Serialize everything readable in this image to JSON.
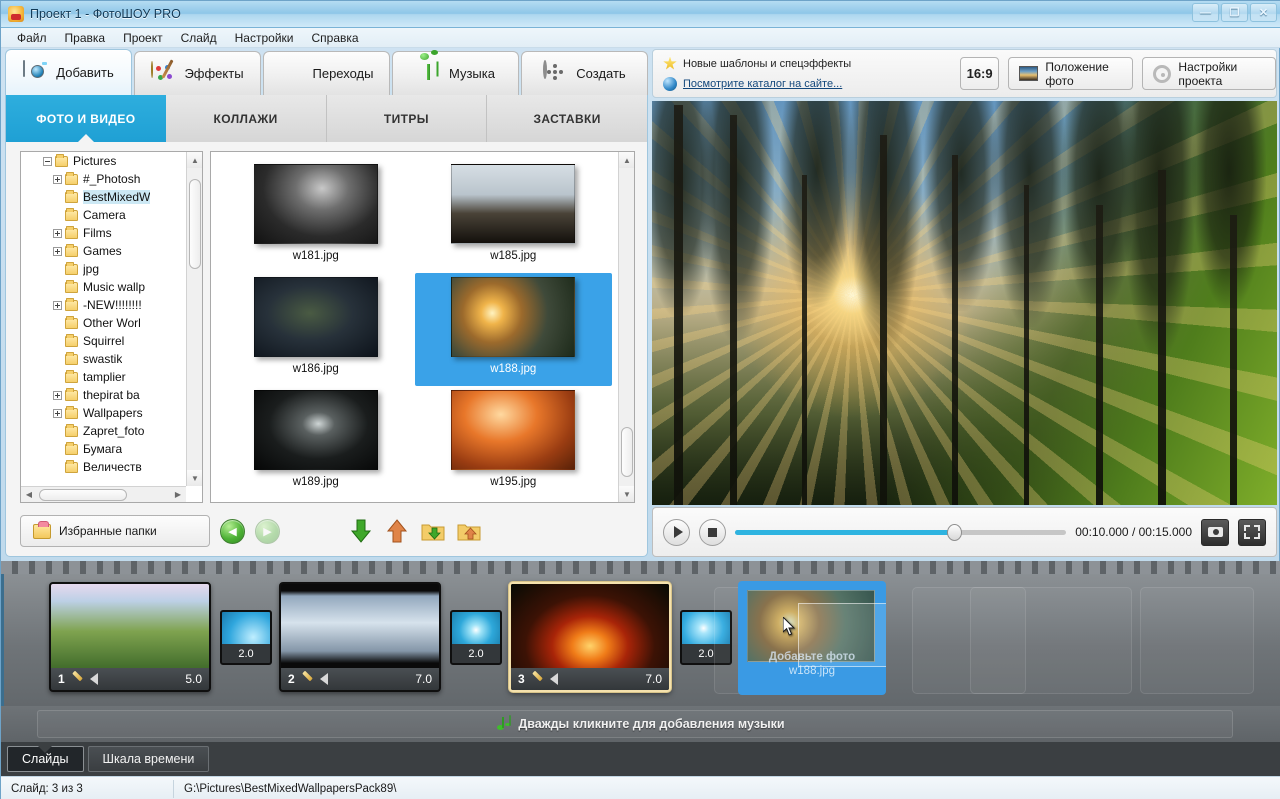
{
  "window": {
    "title": "Проект 1 - ФотоШОУ PRO",
    "app_icon": "crown-pro-icon",
    "minimize_label": "—",
    "maximize_label": "❐",
    "close_label": "✕"
  },
  "menu": {
    "items": [
      {
        "label": "Файл"
      },
      {
        "label": "Правка"
      },
      {
        "label": "Проект"
      },
      {
        "label": "Слайд"
      },
      {
        "label": "Настройки"
      },
      {
        "label": "Справка"
      }
    ]
  },
  "main_tabs": [
    {
      "label": "Добавить",
      "icon": "camera-icon",
      "active": true
    },
    {
      "label": "Эффекты",
      "icon": "palette-icon",
      "active": false
    },
    {
      "label": "Переходы",
      "icon": "star-icon",
      "active": false
    },
    {
      "label": "Музыка",
      "icon": "music-note-icon",
      "active": false
    },
    {
      "label": "Создать",
      "icon": "film-reel-icon",
      "active": false
    }
  ],
  "sub_tabs": [
    {
      "label": "ФОТО И ВИДЕО",
      "active": true
    },
    {
      "label": "КОЛЛАЖИ",
      "active": false
    },
    {
      "label": "ТИТРЫ",
      "active": false
    },
    {
      "label": "ЗАСТАВКИ",
      "active": false
    }
  ],
  "folder_tree": {
    "nodes": [
      {
        "label": "Pictures",
        "level": 0,
        "expander": "minus",
        "selected": false
      },
      {
        "label": "#_Photosh",
        "level": 1,
        "expander": "plus",
        "selected": false
      },
      {
        "label": "BestMixedW",
        "level": 1,
        "expander": "none",
        "selected": true
      },
      {
        "label": "Camera",
        "level": 1,
        "expander": "none",
        "selected": false
      },
      {
        "label": "Films",
        "level": 1,
        "expander": "plus",
        "selected": false
      },
      {
        "label": "Games",
        "level": 1,
        "expander": "plus",
        "selected": false
      },
      {
        "label": "jpg",
        "level": 1,
        "expander": "none",
        "selected": false
      },
      {
        "label": "Music wallp",
        "level": 1,
        "expander": "none",
        "selected": false
      },
      {
        "label": "-NEW!!!!!!!!",
        "level": 1,
        "expander": "plus",
        "selected": false
      },
      {
        "label": "Other Worl",
        "level": 1,
        "expander": "none",
        "selected": false
      },
      {
        "label": "Squirrel",
        "level": 1,
        "expander": "none",
        "selected": false
      },
      {
        "label": "swastik",
        "level": 1,
        "expander": "none",
        "selected": false
      },
      {
        "label": "tamplier",
        "level": 1,
        "expander": "none",
        "selected": false
      },
      {
        "label": "thepirat ba",
        "level": 1,
        "expander": "plus",
        "selected": false
      },
      {
        "label": "Wallpapers",
        "level": 1,
        "expander": "plus",
        "selected": false
      },
      {
        "label": "Zapret_foto",
        "level": 1,
        "expander": "none",
        "selected": false
      },
      {
        "label": "Бумага",
        "level": 1,
        "expander": "none",
        "selected": false
      },
      {
        "label": "Величеств",
        "level": 1,
        "expander": "none",
        "selected": false
      }
    ]
  },
  "file_grid": {
    "items": [
      {
        "name": "w181.jpg",
        "art": "img-w181",
        "selected": false
      },
      {
        "name": "w185.jpg",
        "art": "img-w185",
        "selected": false
      },
      {
        "name": "w186.jpg",
        "art": "img-w186",
        "selected": false
      },
      {
        "name": "w188.jpg",
        "art": "img-w188",
        "selected": true
      },
      {
        "name": "w189.jpg",
        "art": "img-w189",
        "selected": false
      },
      {
        "name": "w195.jpg",
        "art": "img-w195",
        "selected": false
      }
    ]
  },
  "left_toolbar": {
    "favorites_label": "Избранные папки",
    "back_icon": "back-arrow-icon",
    "forward_icon": "forward-arrow-icon",
    "add_down_icon": "green-down-arrow-icon",
    "remove_up_icon": "orange-up-arrow-icon",
    "add_folder_icon": "folder-down-icon",
    "remove_folder_icon": "folder-up-icon"
  },
  "preview_header": {
    "promo_title": "Новые шаблоны и спецэффекты",
    "promo_link": "Посмотрите каталог на сайте...",
    "aspect_ratio": "16:9",
    "photo_position_label": "Положение фото",
    "project_settings_label": "Настройки проекта"
  },
  "player": {
    "play_icon": "play-icon",
    "stop_icon": "stop-icon",
    "time_display": "00:10.000 / 00:15.000",
    "progress_percent": 66,
    "snapshot_icon": "camera-snapshot-icon",
    "fullscreen_icon": "fullscreen-icon"
  },
  "slides": [
    {
      "number": "1",
      "duration": "5.0",
      "art": "art1",
      "active": false
    },
    {
      "number": "2",
      "duration": "7.0",
      "art": "art2",
      "active": false
    },
    {
      "number": "3",
      "duration": "7.0",
      "art": "art3",
      "active": true
    }
  ],
  "transitions": [
    {
      "duration": "2.0",
      "art": "tr1"
    },
    {
      "duration": "2.0",
      "art": "tr2"
    },
    {
      "duration": "2.0",
      "art": "tr3"
    }
  ],
  "drop_target": {
    "hint": "Добавьте фото",
    "filename": "w188.jpg"
  },
  "music_strip": {
    "hint": "Дважды кликните для добавления музыки",
    "icon": "music-note-icon"
  },
  "bottom_tabs": [
    {
      "label": "Слайды",
      "active": true
    },
    {
      "label": "Шкала времени",
      "active": false
    }
  ],
  "status_bar": {
    "slide_info": "Слайд: 3 из 3",
    "path": "G:\\Pictures\\BestMixedWallpapersPack89\\"
  },
  "colors": {
    "accent_blue": "#2eaede",
    "selection_blue": "#3aa2e8",
    "title_gradient": "#8ec6e8",
    "timeline_bg": "#6f7478",
    "dark_tab_bar": "#3b3f42"
  }
}
